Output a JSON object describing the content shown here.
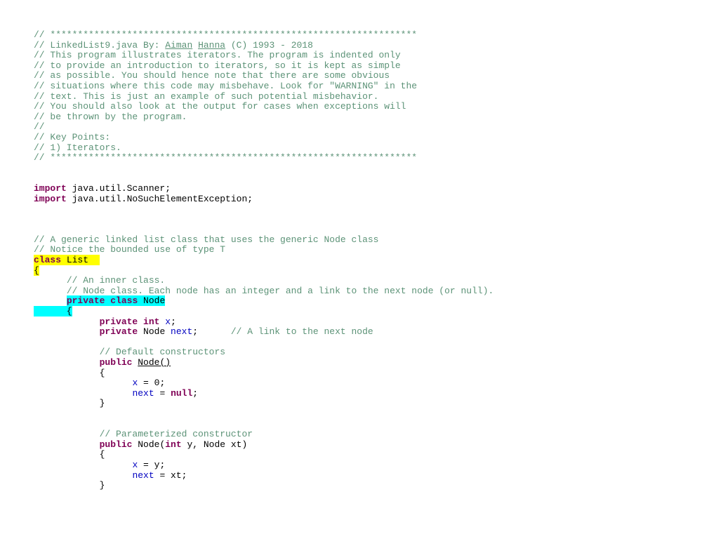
{
  "document": {
    "title": "LinkedList9.java",
    "lines": [
      {
        "segments": [
          {
            "t": "// *******************************************************************",
            "c": "cm"
          }
        ]
      },
      {
        "segments": [
          {
            "t": "// LinkedList9.java By: ",
            "c": "cm"
          },
          {
            "t": "Aiman",
            "c": "cm ul"
          },
          {
            "t": " ",
            "c": "cm"
          },
          {
            "t": "Hanna",
            "c": "cm ul"
          },
          {
            "t": " (C) 1993 - 2018",
            "c": "cm"
          }
        ]
      },
      {
        "segments": [
          {
            "t": "// This program illustrates iterators. The program is indented only",
            "c": "cm"
          }
        ]
      },
      {
        "segments": [
          {
            "t": "// to provide an introduction to iterators, so it is kept as simple",
            "c": "cm"
          }
        ]
      },
      {
        "segments": [
          {
            "t": "// as possible. You should hence note that there are some obvious",
            "c": "cm"
          }
        ]
      },
      {
        "segments": [
          {
            "t": "// situations where this code may misbehave. Look for \"WARNING\" in the",
            "c": "cm"
          }
        ]
      },
      {
        "segments": [
          {
            "t": "// text. This is just an example of such potential misbehavior.",
            "c": "cm"
          }
        ]
      },
      {
        "segments": [
          {
            "t": "// You should also look at the output for cases when exceptions will",
            "c": "cm"
          }
        ]
      },
      {
        "segments": [
          {
            "t": "// be thrown by the program.",
            "c": "cm"
          }
        ]
      },
      {
        "segments": [
          {
            "t": "//",
            "c": "cm"
          }
        ]
      },
      {
        "segments": [
          {
            "t": "// Key Points:",
            "c": "cm"
          }
        ]
      },
      {
        "segments": [
          {
            "t": "// 1) Iterators.",
            "c": "cm"
          }
        ]
      },
      {
        "segments": [
          {
            "t": "// *******************************************************************",
            "c": "cm"
          }
        ]
      },
      {
        "segments": []
      },
      {
        "segments": []
      },
      {
        "segments": [
          {
            "t": "import",
            "c": "kw"
          },
          {
            "t": " java.util.Scanner;",
            "c": "plain"
          }
        ]
      },
      {
        "segments": [
          {
            "t": "import",
            "c": "kw"
          },
          {
            "t": " java.util.NoSuchElementException;",
            "c": "plain"
          }
        ]
      },
      {
        "segments": []
      },
      {
        "segments": []
      },
      {
        "segments": []
      },
      {
        "segments": [
          {
            "t": "// A generic linked list class that uses the generic Node class",
            "c": "cm"
          }
        ]
      },
      {
        "segments": [
          {
            "t": "// Notice the bounded use of type T",
            "c": "cm"
          }
        ]
      },
      {
        "segments": [
          {
            "t": "class",
            "c": "kw hl-yellow"
          },
          {
            "t": " List  ",
            "c": "plain hl-yellow"
          }
        ]
      },
      {
        "segments": [
          {
            "t": "{",
            "c": "plain hl-yellow"
          }
        ]
      },
      {
        "segments": [
          {
            "t": "      ",
            "c": "plain"
          },
          {
            "t": "// An inner class.",
            "c": "cm"
          }
        ]
      },
      {
        "segments": [
          {
            "t": "      ",
            "c": "plain"
          },
          {
            "t": "// Node class. Each node has an integer and a link to the next node (or null).",
            "c": "cm"
          }
        ]
      },
      {
        "segments": [
          {
            "t": "      ",
            "c": "plain"
          },
          {
            "t": "private",
            "c": "kw hl-cyan"
          },
          {
            "t": " ",
            "c": "plain hl-cyan"
          },
          {
            "t": "class",
            "c": "kw hl-cyan"
          },
          {
            "t": " Node",
            "c": "plain hl-cyan"
          }
        ]
      },
      {
        "segments": [
          {
            "t": "      {",
            "c": "plain hl-cyan"
          }
        ]
      },
      {
        "segments": [
          {
            "t": "            ",
            "c": "plain"
          },
          {
            "t": "private",
            "c": "kw"
          },
          {
            "t": " ",
            "c": "plain"
          },
          {
            "t": "int",
            "c": "kw"
          },
          {
            "t": " ",
            "c": "plain"
          },
          {
            "t": "x",
            "c": "fld"
          },
          {
            "t": ";",
            "c": "plain"
          }
        ]
      },
      {
        "segments": [
          {
            "t": "            ",
            "c": "plain"
          },
          {
            "t": "private",
            "c": "kw"
          },
          {
            "t": " Node ",
            "c": "plain"
          },
          {
            "t": "next",
            "c": "fld"
          },
          {
            "t": ";      ",
            "c": "plain"
          },
          {
            "t": "// A link to the next node",
            "c": "cm"
          }
        ]
      },
      {
        "segments": []
      },
      {
        "segments": [
          {
            "t": "            ",
            "c": "plain"
          },
          {
            "t": "// Default constructors",
            "c": "cm"
          }
        ]
      },
      {
        "segments": [
          {
            "t": "            ",
            "c": "plain"
          },
          {
            "t": "public",
            "c": "kw"
          },
          {
            "t": " ",
            "c": "plain"
          },
          {
            "t": "Node()",
            "c": "plain ul"
          }
        ]
      },
      {
        "segments": [
          {
            "t": "            {",
            "c": "plain"
          }
        ]
      },
      {
        "segments": [
          {
            "t": "                  ",
            "c": "plain"
          },
          {
            "t": "x",
            "c": "fld"
          },
          {
            "t": " = 0;",
            "c": "plain"
          }
        ]
      },
      {
        "segments": [
          {
            "t": "                  ",
            "c": "plain"
          },
          {
            "t": "next",
            "c": "fld"
          },
          {
            "t": " = ",
            "c": "plain"
          },
          {
            "t": "null",
            "c": "kw"
          },
          {
            "t": ";",
            "c": "plain"
          }
        ]
      },
      {
        "segments": [
          {
            "t": "            }",
            "c": "plain"
          }
        ]
      },
      {
        "segments": []
      },
      {
        "segments": []
      },
      {
        "segments": [
          {
            "t": "            ",
            "c": "plain"
          },
          {
            "t": "// Parameterized constructor",
            "c": "cm"
          }
        ]
      },
      {
        "segments": [
          {
            "t": "            ",
            "c": "plain"
          },
          {
            "t": "public",
            "c": "kw"
          },
          {
            "t": " Node(",
            "c": "plain"
          },
          {
            "t": "int",
            "c": "kw"
          },
          {
            "t": " y, Node xt)",
            "c": "plain"
          }
        ]
      },
      {
        "segments": [
          {
            "t": "            {",
            "c": "plain"
          }
        ]
      },
      {
        "segments": [
          {
            "t": "                  ",
            "c": "plain"
          },
          {
            "t": "x",
            "c": "fld"
          },
          {
            "t": " = y;",
            "c": "plain"
          }
        ]
      },
      {
        "segments": [
          {
            "t": "                  ",
            "c": "plain"
          },
          {
            "t": "next",
            "c": "fld"
          },
          {
            "t": " = xt;",
            "c": "plain"
          }
        ]
      },
      {
        "segments": [
          {
            "t": "            }",
            "c": "plain"
          }
        ]
      }
    ]
  },
  "colors": {
    "comment": "#3f7f5f",
    "keyword": "#7f0055",
    "field": "#0000c0",
    "highlight_class": "#ffff00",
    "highlight_inner": "#00ffff"
  }
}
